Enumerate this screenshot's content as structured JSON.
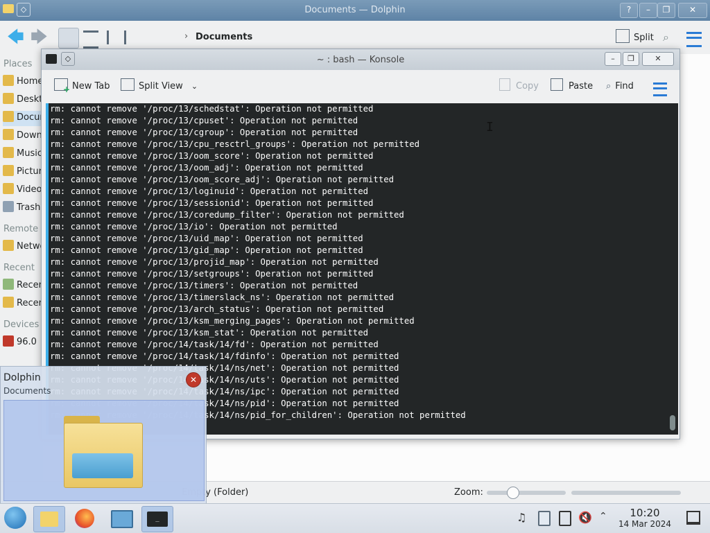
{
  "dolphin": {
    "title": "Documents — Dolphin",
    "breadcrumb": "Documents",
    "split_label": "Split",
    "places": {
      "section_places": "Places",
      "section_remote": "Remote",
      "section_recent": "Recent",
      "section_devices": "Devices",
      "items": [
        {
          "label": "Home"
        },
        {
          "label": "Desktop"
        },
        {
          "label": "Documents"
        },
        {
          "label": "Downloads"
        },
        {
          "label": "Music"
        },
        {
          "label": "Pictures"
        },
        {
          "label": "Videos"
        },
        {
          "label": "Trash"
        }
      ],
      "remote_items": [
        {
          "label": "Network"
        }
      ],
      "recent_items": [
        {
          "label": "Recent Files"
        },
        {
          "label": "Recent Locations"
        }
      ],
      "device_items": [
        {
          "label": "96.0"
        }
      ]
    },
    "status": {
      "text": "Empty (Folder)",
      "zoom_label": "Zoom:",
      "zoom_fraction": 0.3
    }
  },
  "konsole": {
    "title": "~ : bash — Konsole",
    "toolbar": {
      "new_tab": "New Tab",
      "split_view": "Split View",
      "copy": "Copy",
      "paste": "Paste",
      "find": "Find"
    },
    "lines": [
      "rm: cannot remove '/proc/13/schedstat': Operation not permitted",
      "rm: cannot remove '/proc/13/cpuset': Operation not permitted",
      "rm: cannot remove '/proc/13/cgroup': Operation not permitted",
      "rm: cannot remove '/proc/13/cpu_resctrl_groups': Operation not permitted",
      "rm: cannot remove '/proc/13/oom_score': Operation not permitted",
      "rm: cannot remove '/proc/13/oom_adj': Operation not permitted",
      "rm: cannot remove '/proc/13/oom_score_adj': Operation not permitted",
      "rm: cannot remove '/proc/13/loginuid': Operation not permitted",
      "rm: cannot remove '/proc/13/sessionid': Operation not permitted",
      "rm: cannot remove '/proc/13/coredump_filter': Operation not permitted",
      "rm: cannot remove '/proc/13/io': Operation not permitted",
      "rm: cannot remove '/proc/13/uid_map': Operation not permitted",
      "rm: cannot remove '/proc/13/gid_map': Operation not permitted",
      "rm: cannot remove '/proc/13/projid_map': Operation not permitted",
      "rm: cannot remove '/proc/13/setgroups': Operation not permitted",
      "rm: cannot remove '/proc/13/timers': Operation not permitted",
      "rm: cannot remove '/proc/13/timerslack_ns': Operation not permitted",
      "rm: cannot remove '/proc/13/arch_status': Operation not permitted",
      "rm: cannot remove '/proc/13/ksm_merging_pages': Operation not permitted",
      "rm: cannot remove '/proc/13/ksm_stat': Operation not permitted",
      "rm: cannot remove '/proc/14/task/14/fd': Operation not permitted",
      "rm: cannot remove '/proc/14/task/14/fdinfo': Operation not permitted",
      "rm: cannot remove '/proc/14/task/14/ns/net': Operation not permitted",
      "rm: cannot remove '/proc/14/task/14/ns/uts': Operation not permitted",
      "rm: cannot remove '/proc/14/task/14/ns/ipc': Operation not permitted",
      "rm: cannot remove '/proc/14/task/14/ns/pid': Operation not permitted",
      "rm: cannot remove '/proc/14/task/14/ns/pid_for_children': Operation not permitted"
    ]
  },
  "preview": {
    "app": "Dolphin",
    "window": "Documents"
  },
  "taskbar": {
    "time": "10:20",
    "date": "14 Mar 2024"
  },
  "colors": {
    "accent": "#3daee9",
    "terminal_bg": "#232627",
    "terminal_fg": "#fcfcfc"
  }
}
